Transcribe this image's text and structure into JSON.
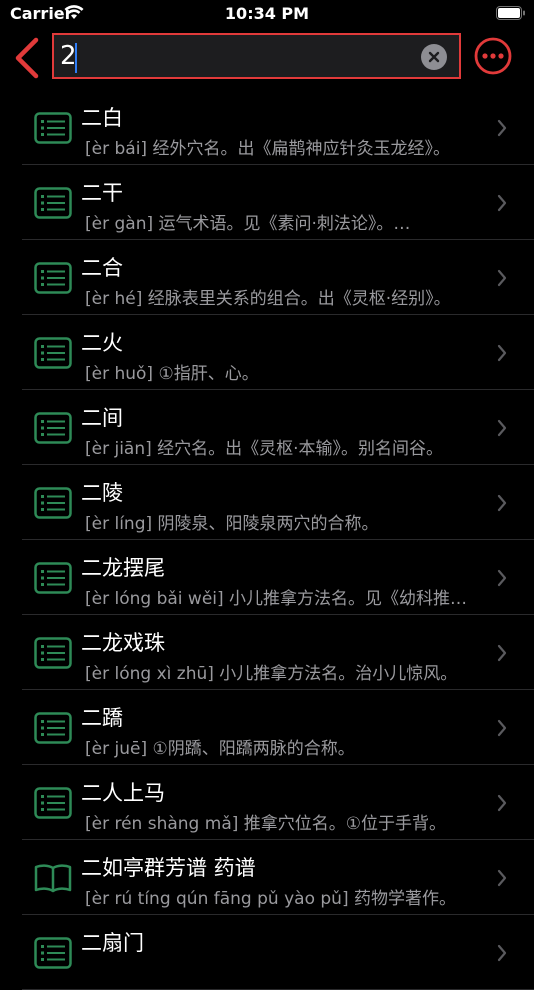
{
  "status_bar": {
    "carrier": "Carrier",
    "time": "10:34 PM"
  },
  "search": {
    "value": "2"
  },
  "colors": {
    "accent": "#e13a3a",
    "icon_green": "#2e8b57",
    "secondary_text": "#9a9a9e"
  },
  "items": [
    {
      "title": "二白",
      "subtitle": "[èr bái]  经外穴名。出《扁鹊神应针灸玉龙经》。",
      "icon": "list-icon"
    },
    {
      "title": "二干",
      "subtitle": "[èr gàn]  运气术语。见《素问·刺法论》。…",
      "icon": "list-icon"
    },
    {
      "title": "二合",
      "subtitle": "[èr hé]  经脉表里关系的组合。出《灵枢·经别》。",
      "icon": "list-icon"
    },
    {
      "title": "二火",
      "subtitle": "[èr huǒ]  ①指肝、心。",
      "icon": "list-icon"
    },
    {
      "title": "二间",
      "subtitle": "[èr jiān]  经穴名。出《灵枢·本输》。别名间谷。",
      "icon": "list-icon"
    },
    {
      "title": "二陵",
      "subtitle": "[èr líng]  阴陵泉、阳陵泉两穴的合称。",
      "icon": "list-icon"
    },
    {
      "title": "二龙摆尾",
      "subtitle": "[èr lóng bǎi wěi]  小儿推拿方法名。见《幼科推拿秘书》。",
      "icon": "list-icon"
    },
    {
      "title": "二龙戏珠",
      "subtitle": "[èr lóng xì zhū]  小儿推拿方法名。治小儿惊风。",
      "icon": "list-icon"
    },
    {
      "title": "二蹻",
      "subtitle": "[èr juē]  ①阴蹻、阳蹻两脉的合称。",
      "icon": "list-icon"
    },
    {
      "title": "二人上马",
      "subtitle": "[èr rén shàng mǎ]  推拿穴位名。①位于手背。",
      "icon": "list-icon"
    },
    {
      "title": "二如亭群芳谱 药谱",
      "subtitle": "[èr rú tíng qún fāng pǔ   yào pǔ]  药物学著作。",
      "icon": "book-icon"
    },
    {
      "title": "二扇门",
      "subtitle": "",
      "icon": "list-icon"
    }
  ]
}
